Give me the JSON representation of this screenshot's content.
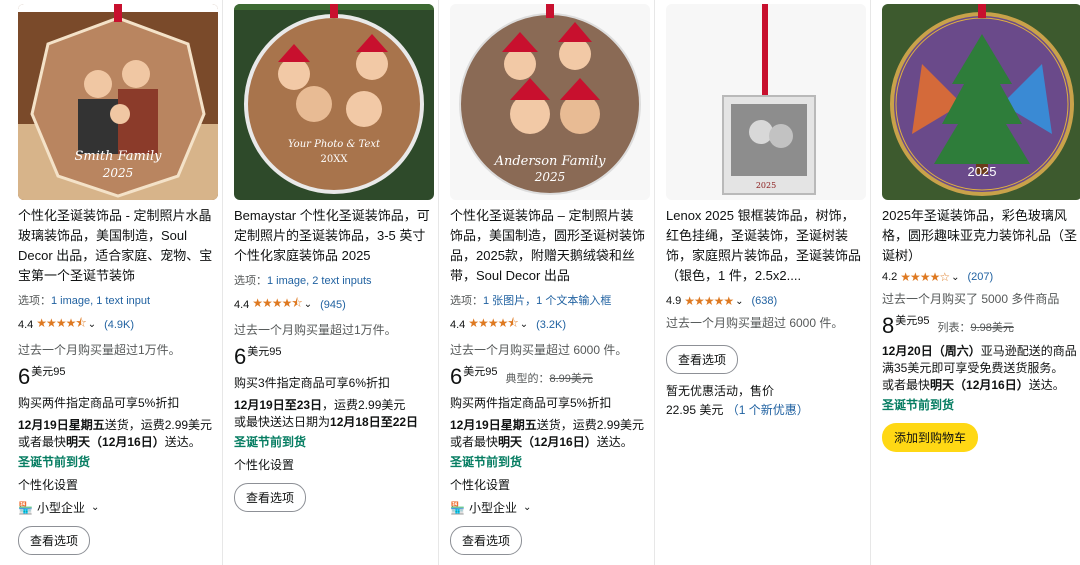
{
  "products": [
    {
      "title": "个性化圣诞装饰品 - 定制照片水晶玻璃装饰品，美国制造，Soul Decor 出品，适合家庭、宠物、宝宝第一个圣诞节装饰",
      "image_caption": "Smith Family",
      "image_year": "2025",
      "options_label": "选项：",
      "options_value": "1 image, 1 text input",
      "rating": "4.4",
      "rating_stars": "★★★★⯪",
      "review_count": "(4.9K)",
      "bought": "过去一个月购买量超过1万件。",
      "price_int": "6",
      "price_unit": "美元95",
      "promo": "购买两件指定商品可享5%折扣",
      "ship_date": "12月19日星期五",
      "ship_text": "送货，运费2.99美元",
      "fast_prefix": "或者最快",
      "fast_date": "明天（12月16日）",
      "fast_suffix": "送达。",
      "xmas": "圣诞节前到货",
      "personalize": "个性化设置",
      "small_biz": "小型企业",
      "button": "查看选项"
    },
    {
      "title": "Bemaystar 个性化圣诞装饰品，可定制照片的圣诞装饰品，3-5 英寸个性化家庭装饰品 2025",
      "image_caption": "Your Photo & Text",
      "image_year": "20XX",
      "options_label": "选项：",
      "options_value": "1 image, 2 text inputs",
      "rating": "4.4",
      "rating_stars": "★★★★⯪",
      "review_count": "(945)",
      "bought": "过去一个月购买量超过1万件。",
      "price_int": "6",
      "price_unit": "美元95",
      "promo": "购买3件指定商品可享6%折扣",
      "ship_date": "12月19日至23日",
      "ship_text": "，运费2.99美元",
      "fast_prefix": "或最快送达日期为",
      "fast_date": "12月18日至22日",
      "xmas": "圣诞节前到货",
      "personalize": "个性化设置",
      "button": "查看选项"
    },
    {
      "title": "个性化圣诞装饰品 – 定制照片装饰品，美国制造，圆形圣诞树装饰品，2025款，附赠天鹅绒袋和丝带，Soul Decor 出品",
      "image_caption": "Anderson Family",
      "image_year": "2025",
      "options_label": "选项：",
      "options_value": "1 张图片，1 个文本输入框",
      "rating": "4.4",
      "rating_stars": "★★★★⯪",
      "review_count": "(3.2K)",
      "bought": "过去一个月购买量超过 6000 件。",
      "price_int": "6",
      "price_unit": "美元95",
      "list_label": "典型的：",
      "list_price": "8.99美元",
      "promo": "购买两件指定商品可享5%折扣",
      "ship_date": "12月19日星期五",
      "ship_text": "送货，运费2.99美元",
      "fast_prefix": "或者最快",
      "fast_date": "明天（12月16日）",
      "fast_suffix": "送达。",
      "xmas": "圣诞节前到货",
      "personalize": "个性化设置",
      "small_biz": "小型企业",
      "button": "查看选项"
    },
    {
      "title": "Lenox 2025 银框装饰品，树饰，红色挂绳，圣诞装饰，圣诞树装饰，家庭照片装饰品，圣诞装饰品（银色，1 件，2.5x2....",
      "image_year": "2025",
      "rating": "4.9",
      "rating_stars": "★★★★★",
      "review_count": "(638)",
      "bought": "过去一个月购买量超过 6000 件。",
      "button": "查看选项",
      "no_offer": "暂无优惠活动，售价",
      "offer_price": "22.95 美元",
      "offer_link": "（1 个新优惠）"
    },
    {
      "title": "2025年圣诞装饰品，彩色玻璃风格，圆形趣味亚克力装饰礼品（圣诞树）",
      "image_year": "2025",
      "rating": "4.2",
      "rating_stars": "★★★★☆",
      "review_count": "(207)",
      "bought": "过去一个月购买了 5000 多件商品",
      "price_int": "8",
      "price_unit": "美元95",
      "list_label": "列表：",
      "list_price": "9.98美元",
      "ship_date": "12月20日（周六）",
      "ship_text": "亚马逊配送的商品满35美元即可享受免费送货服务。",
      "fast_prefix": "或者最快",
      "fast_date": "明天（12月16日）",
      "fast_suffix": "送达。",
      "xmas": "圣诞节前到货",
      "button": "添加到购物车"
    }
  ]
}
